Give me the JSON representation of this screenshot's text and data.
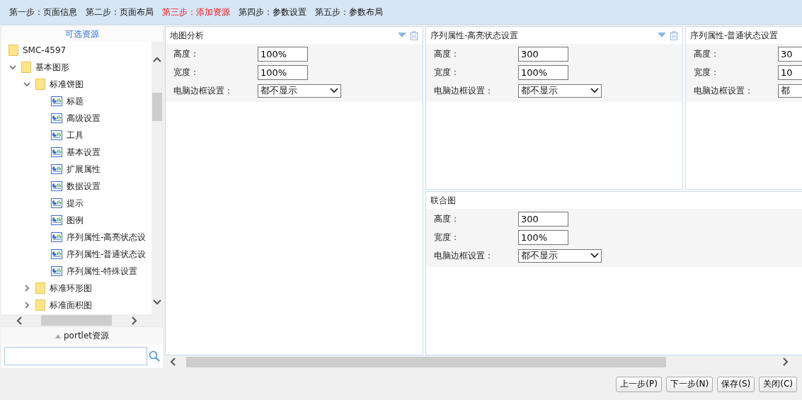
{
  "steps": [
    {
      "label": "第一步：页面信息",
      "selected": false
    },
    {
      "label": "第二步：页面布局",
      "selected": false
    },
    {
      "label": "第三步：添加资源",
      "selected": true
    },
    {
      "label": "第四步：参数设置",
      "selected": false
    },
    {
      "label": "第五步：参数布局",
      "selected": false
    }
  ],
  "resource_panel": {
    "title": "可选资源",
    "tree": [
      {
        "label": "SMC-4597",
        "kind": "folder",
        "children": [
          {
            "label": "基本图形",
            "kind": "folder",
            "expanded": true,
            "children": [
              {
                "label": "标准饼图",
                "kind": "folder",
                "expanded": true,
                "children": [
                  {
                    "label": "标题",
                    "kind": "chart"
                  },
                  {
                    "label": "高级设置",
                    "kind": "chart"
                  },
                  {
                    "label": "工具",
                    "kind": "chart"
                  },
                  {
                    "label": "基本设置",
                    "kind": "chart"
                  },
                  {
                    "label": "扩展属性",
                    "kind": "chart"
                  },
                  {
                    "label": "数据设置",
                    "kind": "chart"
                  },
                  {
                    "label": "提示",
                    "kind": "chart"
                  },
                  {
                    "label": "图例",
                    "kind": "chart"
                  },
                  {
                    "label": "序列属性-高亮状态设",
                    "kind": "chart"
                  },
                  {
                    "label": "序列属性-普通状态设",
                    "kind": "chart"
                  },
                  {
                    "label": "序列属性-特殊设置",
                    "kind": "chart"
                  }
                ]
              },
              {
                "label": "标准环形图",
                "kind": "folder",
                "expanded": false
              },
              {
                "label": "标准面积图",
                "kind": "folder",
                "expanded": false
              }
            ]
          }
        ]
      }
    ],
    "portlet_label": "portlet资源"
  },
  "panels": [
    {
      "title": "地图分析",
      "show_tools": true,
      "fields": [
        {
          "label": "高度：",
          "kind": "input",
          "value": "100%"
        },
        {
          "label": "宽度：",
          "kind": "input",
          "value": "100%"
        },
        {
          "label": "电脑边框设置：",
          "kind": "select",
          "value": "都不显示"
        }
      ]
    },
    {
      "title": "序列属性-高亮状态设置",
      "show_tools": true,
      "fields": [
        {
          "label": "高度：",
          "kind": "input",
          "value": "300"
        },
        {
          "label": "宽度：",
          "kind": "input",
          "value": "100%"
        },
        {
          "label": "电脑边框设置：",
          "kind": "select",
          "value": "都不显示"
        }
      ]
    },
    {
      "title": "序列属性-普通状态设置",
      "fields": [
        {
          "label": "高度：",
          "kind": "input",
          "value": "30"
        },
        {
          "label": "宽度：",
          "kind": "input",
          "value": "10"
        },
        {
          "label": "电脑边框设置：",
          "kind": "select",
          "value": "都"
        }
      ]
    },
    {
      "title": "联合图",
      "fields": [
        {
          "label": "高度：",
          "kind": "input",
          "value": "300"
        },
        {
          "label": "宽度：",
          "kind": "input",
          "value": "100%"
        },
        {
          "label": "电脑边框设置：",
          "kind": "select",
          "value": "都不显示"
        }
      ]
    }
  ],
  "buttons": [
    "上一步(P)",
    "下一步(N)",
    "保存(S)",
    "关闭(C)"
  ]
}
